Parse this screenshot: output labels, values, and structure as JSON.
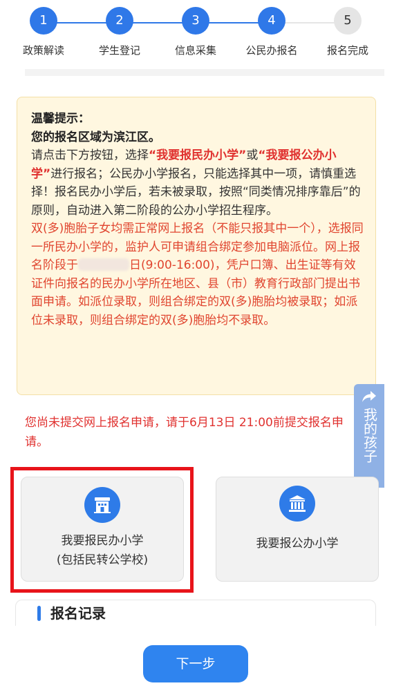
{
  "steps": [
    {
      "num": "1",
      "label": "政策解读"
    },
    {
      "num": "2",
      "label": "学生登记"
    },
    {
      "num": "3",
      "label": "信息采集"
    },
    {
      "num": "4",
      "label": "公民办报名"
    },
    {
      "num": "5",
      "label": "报名完成"
    }
  ],
  "notice": {
    "heading": "温馨提示：",
    "region": "您的报名区域为滨江区。",
    "p1_a": "请点击下方按钮，选择",
    "p1_private": "“我要报民办小学”",
    "p1_or": "或",
    "p1_public": "“我要报公办小学”",
    "p1_b": "进行报名；公民办小学报名，只能选择其中一项，请慎重选择！报名民办小学后，若未被录取，按照“同类情况排序靠后”的原则，自动进入第二阶段的公办小学招生程序。",
    "p2_a": "双(多)胞胎子女均需正常网上报名（不能只报其中一个），选报同一所民办小学的，监护人可申请组合绑定参加电脑派位。网上报名阶段于",
    "p2_b": "日(9:00-16:00)，凭户口簿、出生证等有效证件向报名的民办小学所在地区、县（市）教育行政部门提出书面申请。如派位录取，则组合绑定的双(多)胞胎均被录取；如派位未录取，则组合绑定的双(多)胞胎均不录取。"
  },
  "warning": "您尚未提交网上报名申请，请于6月13日 21:00前提交报名申请。",
  "float_tab": {
    "label": "我的孩子"
  },
  "options": {
    "private_line1": "我要报民办小学",
    "private_line2": "(包括民转公学校)",
    "public_label": "我要报公办小学"
  },
  "record": {
    "title": "报名记录"
  },
  "next_button": "下一步",
  "colors": {
    "accent": "#2f78e8",
    "warning": "#e0312f",
    "highlight_frame": "#e8141a"
  }
}
